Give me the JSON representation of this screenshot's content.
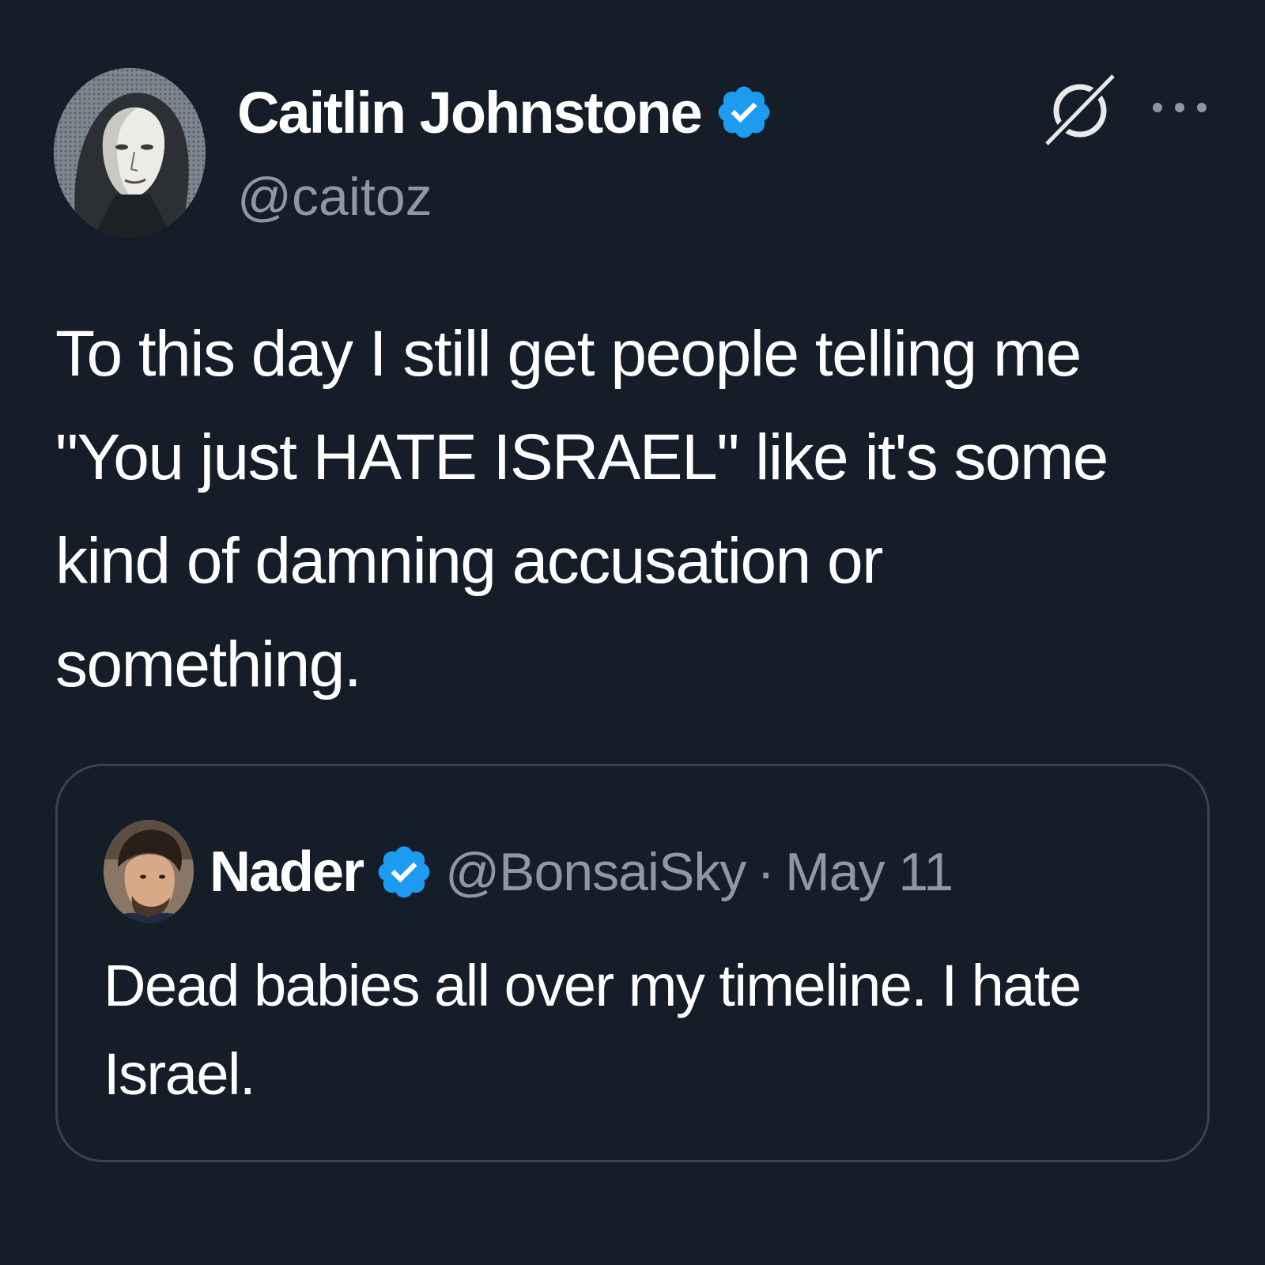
{
  "tweet": {
    "author": {
      "display_name": "Caitlin Johnstone",
      "handle": "@caitoz",
      "verified": true
    },
    "text": "To this day I still get people telling me \"You just HATE ISRAEL\" like it's some kind of damning accusation or something.",
    "icons": {
      "grok": "grok-icon",
      "more": "more-options-icon"
    },
    "quoted": {
      "author": {
        "display_name": "Nader",
        "handle": "@BonsaiSky",
        "verified": true
      },
      "separator": "·",
      "date": "May 11",
      "text": "Dead babies all over my timeline. I hate Israel."
    }
  },
  "colors": {
    "background": "#151d28",
    "text_primary": "#ffffff",
    "text_secondary": "#8b98a5",
    "verified_blue": "#1d9bf0",
    "card_border": "#38444d"
  }
}
